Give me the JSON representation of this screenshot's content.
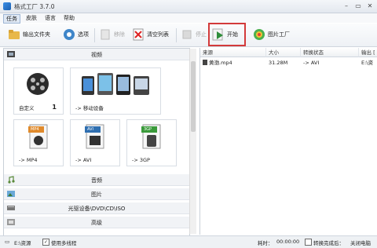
{
  "window": {
    "title": "格式工厂 3.7.0"
  },
  "menu": [
    "任务",
    "皮肤",
    "语言",
    "帮助"
  ],
  "toolbar": {
    "output_folder": "输出文件夹",
    "options": "选项",
    "remove": "移除",
    "clear_list": "清空列表",
    "stop": "停止",
    "start": "开始",
    "picture_factory": "图片工厂"
  },
  "categories": {
    "video": "视频",
    "audio": "音频",
    "picture": "图片",
    "rom": "光驱设备\\DVD\\CD\\ISO",
    "advanced": "高级"
  },
  "tiles": [
    {
      "label": "自定义",
      "count": "1"
    },
    {
      "label": "-> 移动设备"
    },
    {
      "label": "-> MP4",
      "badge": "MP4"
    },
    {
      "label": "-> AVI",
      "badge": "AVI"
    },
    {
      "label": "-> 3GP",
      "badge": "3GP"
    }
  ],
  "file_table": {
    "headers": [
      "来源",
      "大小",
      "转换状态",
      "输出 ["
    ],
    "rows": [
      {
        "source": "黄渤.mp4",
        "size": "31.28M",
        "status": "-> AVI",
        "output": "E:\\资"
      }
    ]
  },
  "statusbar": {
    "output_path": "E:\\资源",
    "multithread": "使用多线程",
    "elapsed_label": "耗时：",
    "elapsed": "00:00:00",
    "after_done": "转换完成后：",
    "shutdown": "关闭电脑"
  },
  "colors": {
    "accent": "#2f8d3b",
    "highlight": "#d33a3a"
  }
}
